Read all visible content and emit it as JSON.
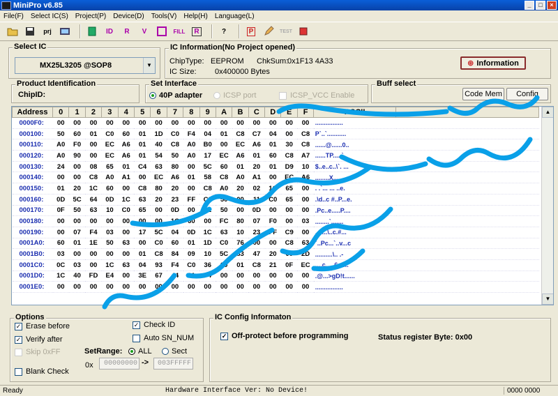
{
  "window": {
    "title": "MiniPro v6.85"
  },
  "menu": [
    "File(F)",
    "Select IC(S)",
    "Project(P)",
    "Device(D)",
    "Tools(V)",
    "Help(H)",
    "Language(L)"
  ],
  "toolbar": {
    "prj": "prj",
    "fill": "FILL",
    "test": "TEST"
  },
  "select_ic": {
    "label": "Select IC",
    "value": "MX25L3205  @SOP8"
  },
  "ic_info": {
    "label": "IC Information(No Project opened)",
    "chiptype_label": "ChipType:",
    "chiptype": "EEPROM",
    "chksum_label": "ChkSum:",
    "chksum": "0x1F13 4A33",
    "icsize_label": "IC Size:",
    "icsize": "0x400000 Bytes",
    "info_button": "Information"
  },
  "product": {
    "label": "Product Identification",
    "chipid_label": "ChipID:"
  },
  "interface": {
    "label": "Set Interface",
    "opt1": "40P adapter",
    "opt2": "ICSP port",
    "opt3": "ICSP_VCC Enable"
  },
  "buff": {
    "label": "Buff select",
    "code_mem": "Code Mem",
    "config": "Config"
  },
  "hex": {
    "headers": [
      "Address",
      "0",
      "1",
      "2",
      "3",
      "4",
      "5",
      "6",
      "7",
      "8",
      "9",
      "A",
      "B",
      "C",
      "D",
      "E",
      "F",
      "ASCII"
    ],
    "rows": [
      {
        "addr": "0000F0:",
        "b": [
          "00",
          "00",
          "00",
          "00",
          "00",
          "00",
          "00",
          "00",
          "00",
          "00",
          "00",
          "00",
          "00",
          "00",
          "00",
          "00"
        ],
        "ascii": "................"
      },
      {
        "addr": "000100:",
        "b": [
          "50",
          "60",
          "01",
          "C0",
          "60",
          "01",
          "1D",
          "C0",
          "F4",
          "04",
          "01",
          "C8",
          "C7",
          "04",
          "00",
          "C8"
        ],
        "ascii": "P`..`..........."
      },
      {
        "addr": "000110:",
        "b": [
          "A0",
          "F0",
          "00",
          "EC",
          "A6",
          "01",
          "40",
          "C8",
          "A0",
          "B0",
          "00",
          "EC",
          "A6",
          "01",
          "30",
          "C8"
        ],
        "ascii": "......@......0.."
      },
      {
        "addr": "000120:",
        "b": [
          "A0",
          "90",
          "00",
          "EC",
          "A6",
          "01",
          "54",
          "50",
          "A0",
          "17",
          "EC",
          "A6",
          "01",
          "60",
          "C8",
          "A7"
        ],
        "ascii": "......TP.....`.."
      },
      {
        "addr": "000130:",
        "b": [
          "24",
          "00",
          "08",
          "65",
          "01",
          "C4",
          "63",
          "80",
          "00",
          "5C",
          "60",
          "01",
          "20",
          "01",
          "D9",
          "10"
        ],
        "ascii": "$..e..c..\\`. ..."
      },
      {
        "addr": "000140:",
        "b": [
          "00",
          "00",
          "C8",
          "A0",
          "A1",
          "00",
          "EC",
          "A6",
          "01",
          "58",
          "C8",
          "A0",
          "A1",
          "00",
          "EC",
          "A6"
        ],
        "ascii": "........X......."
      },
      {
        "addr": "000150:",
        "b": [
          "01",
          "20",
          "1C",
          "60",
          "00",
          "C8",
          "80",
          "20",
          "00",
          "C8",
          "A0",
          "20",
          "02",
          "1C",
          "65",
          "00"
        ],
        "ascii": ". .`... ... ..e."
      },
      {
        "addr": "000160:",
        "b": [
          "0D",
          "5C",
          "64",
          "0D",
          "1C",
          "63",
          "20",
          "23",
          "FF",
          "C9",
          "50",
          "00",
          "11",
          "C0",
          "65",
          "00"
        ],
        "ascii": ".\\d..c #..P...e."
      },
      {
        "addr": "000170:",
        "b": [
          "0F",
          "50",
          "63",
          "10",
          "C0",
          "65",
          "00",
          "0D",
          "00",
          "01",
          "50",
          "00",
          "0D",
          "00",
          "00",
          "00"
        ],
        "ascii": ".Pc..e.....P...."
      },
      {
        "addr": "000180:",
        "b": [
          "00",
          "00",
          "00",
          "00",
          "00",
          "00",
          "00",
          "1C",
          "60",
          "00",
          "FC",
          "80",
          "07",
          "F0",
          "00",
          "03"
        ],
        "ascii": "........`......."
      },
      {
        "addr": "000190:",
        "b": [
          "00",
          "07",
          "F4",
          "03",
          "00",
          "17",
          "5C",
          "04",
          "0D",
          "1C",
          "63",
          "10",
          "23",
          "FF",
          "C9",
          "00"
        ],
        "ascii": ".......\\..c.#..."
      },
      {
        "addr": "0001A0:",
        "b": [
          "60",
          "01",
          "1E",
          "50",
          "63",
          "00",
          "C0",
          "60",
          "01",
          "1D",
          "C0",
          "76",
          "00",
          "00",
          "C8",
          "63"
        ],
        "ascii": "`..Pc...`..v...c"
      },
      {
        "addr": "0001B0:",
        "b": [
          "03",
          "00",
          "00",
          "00",
          "00",
          "01",
          "C8",
          "84",
          "09",
          "10",
          "5C",
          "83",
          "47",
          "20",
          "00",
          "2D"
        ],
        "ascii": "..........\\..  .-"
      },
      {
        "addr": "0001C0:",
        "b": [
          "0C",
          "03",
          "00",
          "1C",
          "63",
          "04",
          "93",
          "F4",
          "C0",
          "36",
          "00",
          "01",
          "C8",
          "21",
          "0F",
          "EC"
        ],
        "ascii": "....c.....6...!.."
      },
      {
        "addr": "0001D0:",
        "b": [
          "1C",
          "40",
          "FD",
          "E4",
          "00",
          "3E",
          "67",
          "44",
          "21",
          "74",
          "00",
          "00",
          "00",
          "00",
          "00",
          "00"
        ],
        "ascii": ".@...>gD!t......"
      },
      {
        "addr": "0001E0:",
        "b": [
          "00",
          "00",
          "00",
          "00",
          "00",
          "00",
          "00",
          "00",
          "00",
          "00",
          "00",
          "00",
          "00",
          "00",
          "00",
          "00"
        ],
        "ascii": "................"
      }
    ]
  },
  "options": {
    "label": "Options",
    "erase": "Erase before",
    "verify": "Verify after",
    "skip": "Skip 0xFF",
    "blank": "Blank Check",
    "checkid": "Check ID",
    "autosn": "Auto SN_NUM",
    "setrange": "SetRange:",
    "all": "ALL",
    "sect": "Sect",
    "prefix": "0x",
    "from": "00000000",
    "arrow": "->",
    "to": "003FFFFF"
  },
  "ic_config": {
    "label": "IC Config Informaton",
    "offprotect": "Off-protect before programming",
    "status_reg": "Status register Byte: 0x00"
  },
  "status": {
    "left": "Ready",
    "center": "Hardware Interface Ver: No Device!",
    "right": "0000 0000"
  },
  "colors": {
    "title": "#0a5fd8",
    "watermark": "#0aa0e8",
    "address": "#1c2fb0"
  }
}
